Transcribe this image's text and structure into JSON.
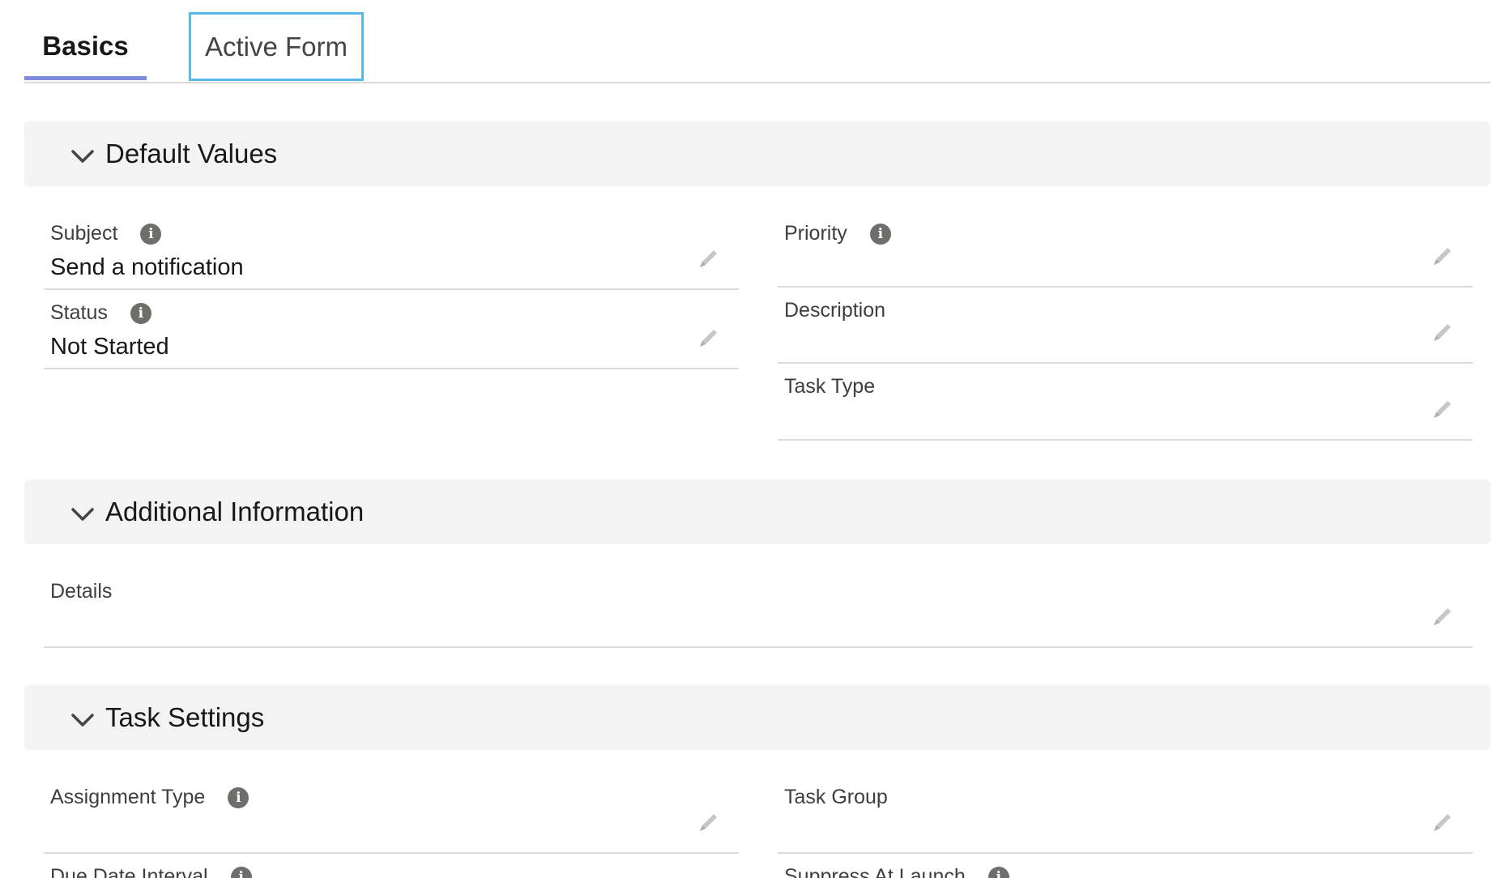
{
  "tabs": [
    {
      "label": "Basics"
    },
    {
      "label": "Active Form"
    }
  ],
  "sections": {
    "default_values": {
      "title": "Default Values",
      "subject": {
        "label": "Subject",
        "value": "Send a notification"
      },
      "status": {
        "label": "Status",
        "value": "Not Started"
      },
      "priority": {
        "label": "Priority",
        "value": ""
      },
      "description": {
        "label": "Description",
        "value": ""
      },
      "task_type": {
        "label": "Task Type",
        "value": ""
      }
    },
    "additional_information": {
      "title": "Additional Information",
      "details": {
        "label": "Details",
        "value": ""
      }
    },
    "task_settings": {
      "title": "Task Settings",
      "assignment_type": {
        "label": "Assignment Type",
        "value": ""
      },
      "task_group": {
        "label": "Task Group",
        "value": ""
      },
      "due_date_interval": {
        "label": "Due Date Interval",
        "value": ""
      },
      "suppress_at_launch": {
        "label": "Suppress At Launch",
        "value": ""
      }
    }
  },
  "icons": {
    "info": "info-icon",
    "edit": "pencil-icon",
    "collapse": "chevron-down-icon"
  },
  "colors": {
    "active_tab_underline": "#7f8de1",
    "focus_border": "#56b9e8",
    "section_bg": "#f3f3f3",
    "info_icon": "#706e6b"
  }
}
